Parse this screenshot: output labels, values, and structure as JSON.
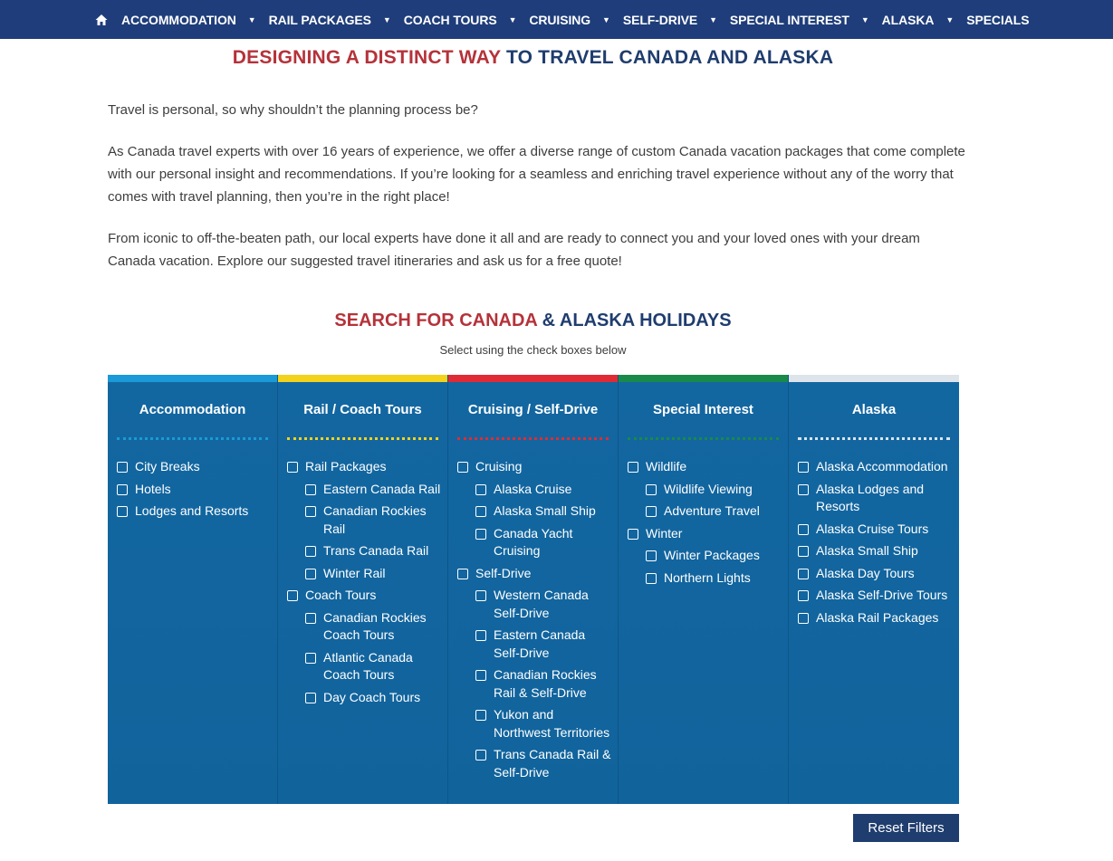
{
  "nav": {
    "items": [
      {
        "label": "ACCOMMODATION"
      },
      {
        "label": "RAIL PACKAGES"
      },
      {
        "label": "COACH TOURS"
      },
      {
        "label": "CRUISING"
      },
      {
        "label": "SELF-DRIVE"
      },
      {
        "label": "SPECIAL INTEREST"
      },
      {
        "label": "ALASKA"
      },
      {
        "label": "SPECIALS"
      }
    ],
    "caret": "▼"
  },
  "intro": {
    "heading_red": "DESIGNING A DISTINCT WAY",
    "heading_navy": " TO TRAVEL CANADA AND ALASKA",
    "p1": "Travel is personal, so why shouldn’t the planning process be?",
    "p2": "As Canada travel experts with over 16 years of experience, we offer a diverse range of custom Canada vacation packages that come complete with our personal insight and recommendations. If you’re looking for a seamless and enriching travel experience without any of the worry that comes with travel planning, then you’re in the right place!",
    "p3": "From iconic to off-the-beaten path, our local experts have done it all and are ready to connect you and your loved ones with your dream Canada vacation. Explore our suggested travel itineraries and ask us for a free quote!"
  },
  "search": {
    "heading_red": "SEARCH FOR CANADA",
    "heading_navy": " & ALASKA HOLIDAYS",
    "subline": "Select using the check boxes below"
  },
  "filters": {
    "columns": [
      {
        "title": "Accommodation",
        "color": "#1a9ad6",
        "options": [
          {
            "label": "City Breaks",
            "level": 0
          },
          {
            "label": "Hotels",
            "level": 0
          },
          {
            "label": "Lodges and Resorts",
            "level": 0
          }
        ]
      },
      {
        "title": "Rail / Coach Tours",
        "color": "#f3d21b",
        "options": [
          {
            "label": "Rail Packages",
            "level": 0
          },
          {
            "label": "Eastern Canada Rail",
            "level": 1
          },
          {
            "label": "Canadian Rockies Rail",
            "level": 1
          },
          {
            "label": "Trans Canada Rail",
            "level": 1
          },
          {
            "label": "Winter Rail",
            "level": 1
          },
          {
            "label": "Coach Tours",
            "level": 0
          },
          {
            "label": "Canadian Rockies Coach Tours",
            "level": 1
          },
          {
            "label": "Atlantic Canada Coach Tours",
            "level": 1
          },
          {
            "label": "Day Coach Tours",
            "level": 1
          }
        ]
      },
      {
        "title": "Cruising / Self-Drive",
        "color": "#e12b34",
        "options": [
          {
            "label": "Cruising",
            "level": 0
          },
          {
            "label": "Alaska Cruise",
            "level": 1
          },
          {
            "label": "Alaska Small Ship",
            "level": 1
          },
          {
            "label": "Canada Yacht Cruising",
            "level": 1
          },
          {
            "label": "Self-Drive",
            "level": 0
          },
          {
            "label": "Western Canada Self-Drive",
            "level": 1
          },
          {
            "label": "Eastern Canada Self-Drive",
            "level": 1
          },
          {
            "label": "Canadian Rockies Rail & Self-Drive",
            "level": 1
          },
          {
            "label": "Yukon and Northwest Territories",
            "level": 1
          },
          {
            "label": "Trans Canada Rail & Self-Drive",
            "level": 1
          }
        ]
      },
      {
        "title": "Special Interest",
        "color": "#1a8a4a",
        "options": [
          {
            "label": "Wildlife",
            "level": 0
          },
          {
            "label": "Wildlife Viewing",
            "level": 1
          },
          {
            "label": "Adventure Travel",
            "level": 1
          },
          {
            "label": "Winter",
            "level": 0
          },
          {
            "label": "Winter Packages",
            "level": 1
          },
          {
            "label": "Northern Lights",
            "level": 1
          }
        ]
      },
      {
        "title": "Alaska",
        "color": "#dde4ea",
        "options": [
          {
            "label": "Alaska Accommodation",
            "level": 0
          },
          {
            "label": "Alaska Lodges and Resorts",
            "level": 0
          },
          {
            "label": "Alaska Cruise Tours",
            "level": 0
          },
          {
            "label": "Alaska Small Ship",
            "level": 0
          },
          {
            "label": "Alaska Day Tours",
            "level": 0
          },
          {
            "label": "Alaska Self-Drive Tours",
            "level": 0
          },
          {
            "label": "Alaska Rail Packages",
            "level": 0
          }
        ]
      }
    ],
    "reset_label": "Reset Filters"
  }
}
